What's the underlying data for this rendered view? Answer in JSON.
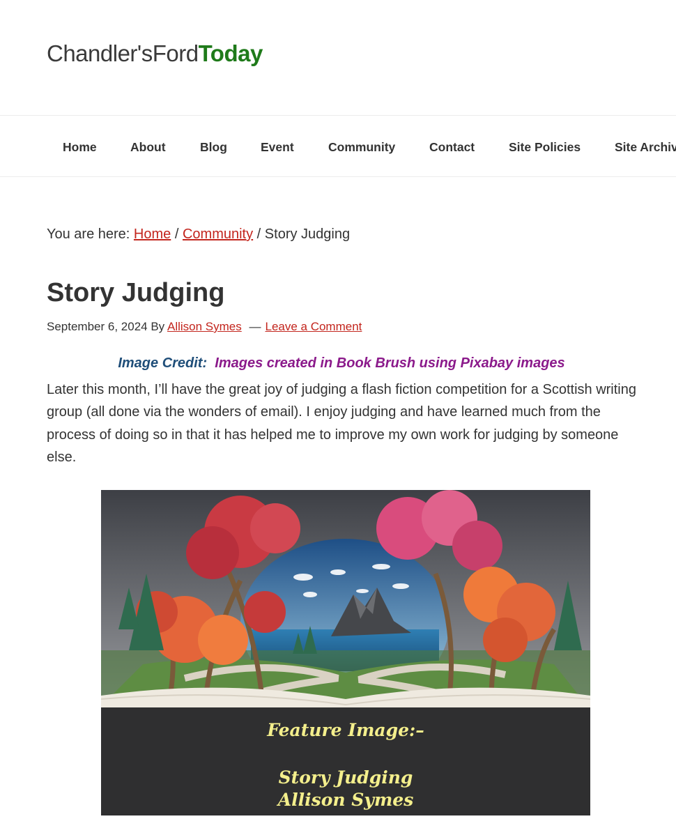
{
  "logo": {
    "part1": "Chandler's",
    "part2": "Ford",
    "part3": "Today"
  },
  "nav": {
    "items": [
      {
        "label": "Home"
      },
      {
        "label": "About"
      },
      {
        "label": "Blog"
      },
      {
        "label": "Event"
      },
      {
        "label": "Community"
      },
      {
        "label": "Contact"
      },
      {
        "label": "Site Policies"
      },
      {
        "label": "Site Archive"
      }
    ]
  },
  "breadcrumb": {
    "prefix": "You are here:",
    "home": "Home",
    "separator": "/",
    "community": "Community",
    "current": "Story Judging"
  },
  "article": {
    "title": "Story Judging",
    "date": "September 6, 2024",
    "by": "By",
    "author": "Allison Symes",
    "dash": "—",
    "comment_link": "Leave a Comment",
    "credit_label": "Image Credit:",
    "credit_value": "Images created in Book Brush using Pixabay images",
    "paragraph": "Later this month, I’ll have the great joy of judging a flash fiction competition for a Scottish writing group (all done via the wonders of email). I enjoy judging and have learned much from the process of doing so in that it has helped me to improve my own work for judging by someone else."
  },
  "feature_image": {
    "caption_line1": "Feature Image:–",
    "caption_line2": "Story Judging",
    "caption_line3": "Allison Symes"
  },
  "colors": {
    "link": "#c3251d",
    "logo_green": "#1f7a1a",
    "credit_label": "#1f4e79",
    "credit_value": "#8b1a8b",
    "caption": "#f4ef8c"
  }
}
